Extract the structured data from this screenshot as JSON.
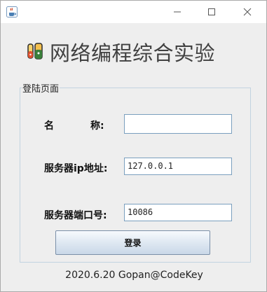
{
  "window": {
    "app_icon": "java-cup-icon",
    "controls": [
      "minimize-icon",
      "maximize-icon",
      "close-icon"
    ]
  },
  "header": {
    "logo_icon": "test-tubes-icon",
    "title": "网络编程综合实验"
  },
  "login_panel": {
    "legend": "登陆页面",
    "fields": {
      "name": {
        "label_a": "名",
        "label_b": "称:",
        "value": ""
      },
      "server_ip": {
        "label": "服务器ip地址:",
        "value": "127.0.0.1"
      },
      "server_port": {
        "label": "服务器端口号:",
        "value": "10086"
      }
    },
    "login_button": "登录"
  },
  "footer": {
    "text": "2020.6.20 Gopan@CodeKey"
  },
  "colors": {
    "background": "#eeeeee",
    "field_border": "#7a9fbe",
    "group_border": "#c2d3e0"
  }
}
